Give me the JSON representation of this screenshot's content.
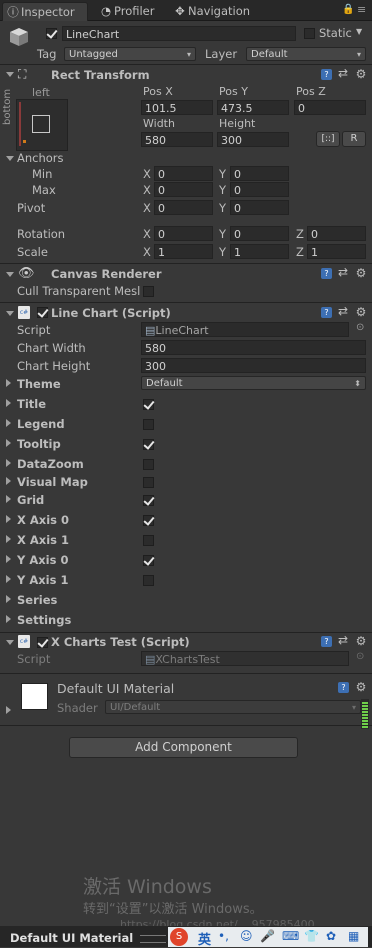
{
  "tabs": [
    {
      "label": "Inspector",
      "icon": "info-icon"
    },
    {
      "label": "Profiler",
      "icon": "profiler-icon"
    },
    {
      "label": "Navigation",
      "icon": "navigation-icon"
    }
  ],
  "object": {
    "name": "LineChart",
    "static_label": "Static",
    "tag_label": "Tag",
    "tag_value": "Untagged",
    "layer_label": "Layer",
    "layer_value": "Default"
  },
  "rect_transform": {
    "title": "Rect Transform",
    "anchor_h": "left",
    "anchor_v": "bottom",
    "pos_x_label": "Pos X",
    "pos_y_label": "Pos Y",
    "pos_z_label": "Pos Z",
    "pos_x": "101.5",
    "pos_y": "473.5",
    "pos_z": "0",
    "width_label": "Width",
    "height_label": "Height",
    "width": "580",
    "height": "300",
    "r_label": "R",
    "anchors_label": "Anchors",
    "min_label": "Min",
    "max_label": "Max",
    "pivot_label": "Pivot",
    "min_x": "0",
    "min_y": "0",
    "max_x": "0",
    "max_y": "0",
    "pivot_x": "0",
    "pivot_y": "0",
    "rotation_label": "Rotation",
    "rot_x": "0",
    "rot_y": "0",
    "rot_z": "0",
    "scale_label": "Scale",
    "scale_x": "1",
    "scale_y": "1",
    "scale_z": "1",
    "x": "X",
    "y": "Y",
    "z": "Z"
  },
  "canvas_renderer": {
    "title": "Canvas Renderer",
    "cull_label": "Cull Transparent Mesl"
  },
  "line_chart": {
    "title": "Line Chart (Script)",
    "script_label": "Script",
    "script_value": "LineChart",
    "chart_width_label": "Chart Width",
    "chart_width": "580",
    "chart_height_label": "Chart Height",
    "chart_height": "300",
    "theme_label": "Theme",
    "theme_value": "Default",
    "props": [
      {
        "label": "Title",
        "checked": true
      },
      {
        "label": "Legend",
        "checked": false
      },
      {
        "label": "Tooltip",
        "checked": true
      },
      {
        "label": "DataZoom",
        "checked": false
      },
      {
        "label": "Visual Map",
        "checked": false
      },
      {
        "label": "Grid",
        "checked": true
      },
      {
        "label": "X Axis 0",
        "checked": true
      },
      {
        "label": "X Axis 1",
        "checked": false
      },
      {
        "label": "Y Axis 0",
        "checked": true
      },
      {
        "label": "Y Axis 1",
        "checked": false
      }
    ],
    "series_label": "Series",
    "settings_label": "Settings"
  },
  "xcharts_test": {
    "title": "X Charts Test (Script)",
    "script_label": "Script",
    "script_value": "XChartsTest"
  },
  "material": {
    "title": "Default UI Material",
    "shader_label": "Shader",
    "shader_value": "UI/Default"
  },
  "add_component": "Add Component",
  "watermark": {
    "line1": "激活 Windows",
    "line2": "转到“设置”以激活 Windows。",
    "line3": "https://blog.csdn.net/... 957985400"
  },
  "bottom_bar": {
    "label": "Default UI Material",
    "ime": "英"
  }
}
